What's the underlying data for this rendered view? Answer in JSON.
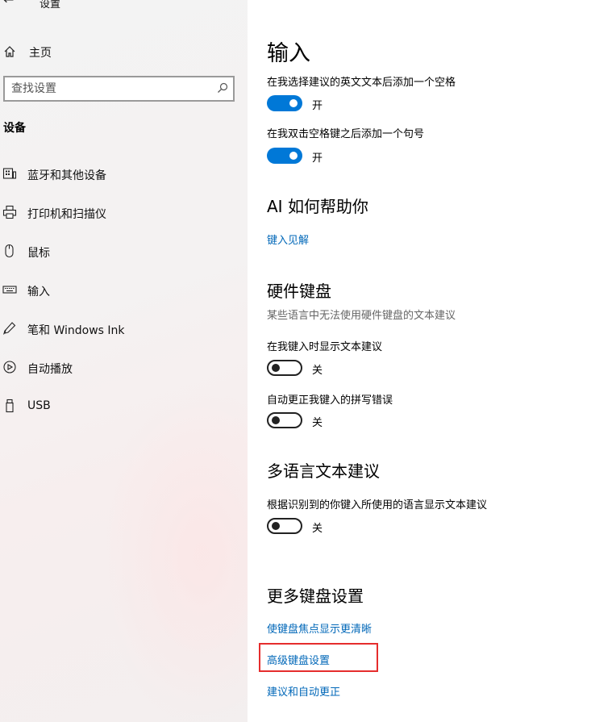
{
  "window": {
    "back_glyph": "←",
    "title": "设置"
  },
  "sidebar": {
    "home_label": "主页",
    "search_placeholder": "查找设置",
    "section_label": "设备",
    "items": [
      {
        "label": "蓝牙和其他设备",
        "icon": "bluetooth-devices-icon"
      },
      {
        "label": "打印机和扫描仪",
        "icon": "printer-icon"
      },
      {
        "label": "鼠标",
        "icon": "mouse-icon"
      },
      {
        "label": "输入",
        "icon": "keyboard-icon"
      },
      {
        "label": "笔和 Windows Ink",
        "icon": "pen-icon"
      },
      {
        "label": "自动播放",
        "icon": "autoplay-icon"
      },
      {
        "label": "USB",
        "icon": "usb-icon"
      }
    ]
  },
  "main": {
    "title": "输入",
    "toggles_top": [
      {
        "label": "在我选择建议的英文文本后添加一个空格",
        "state": "开",
        "on": true
      },
      {
        "label": "在我双击空格键之后添加一个句号",
        "state": "开",
        "on": true
      }
    ],
    "ai_section": {
      "heading": "AI 如何帮助你",
      "link": "键入见解"
    },
    "hardware_section": {
      "heading": "硬件键盘",
      "subtitle": "某些语言中无法使用硬件键盘的文本建议",
      "toggles": [
        {
          "label": "在我键入时显示文本建议",
          "state": "关",
          "on": false
        },
        {
          "label": "自动更正我键入的拼写错误",
          "state": "关",
          "on": false
        }
      ]
    },
    "multilang_section": {
      "heading": "多语言文本建议",
      "toggle": {
        "label": "根据识别到的你键入所使用的语言显示文本建议",
        "state": "关",
        "on": false
      }
    },
    "more_section": {
      "heading": "更多键盘设置",
      "links": [
        "使键盘焦点显示更清晰",
        "高级键盘设置",
        "建议和自动更正"
      ]
    }
  },
  "colors": {
    "accent": "#0078d7",
    "link": "#0067b8",
    "highlight": "#e52d2d"
  }
}
